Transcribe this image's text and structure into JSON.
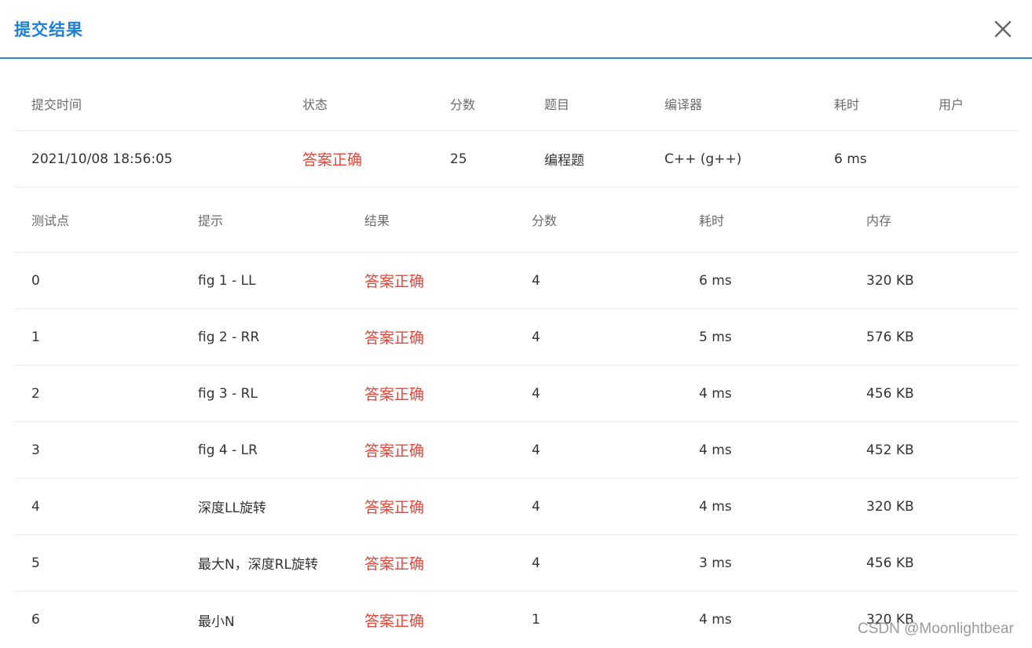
{
  "dialog": {
    "title": "提交结果",
    "close_icon": "close-icon"
  },
  "summary": {
    "headers": [
      "提交时间",
      "状态",
      "分数",
      "题目",
      "编译器",
      "耗时",
      "用户"
    ],
    "row": {
      "time": "2021/10/08 18:56:05",
      "status": "答案正确",
      "score": "25",
      "problem": "编程题",
      "compiler": "C++ (g++)",
      "duration": "6 ms",
      "user": ""
    }
  },
  "cases": {
    "headers": [
      "测试点",
      "提示",
      "结果",
      "分数",
      "耗时",
      "内存"
    ],
    "rows": [
      {
        "id": "0",
        "hint": "fig 1 - LL",
        "result": "答案正确",
        "score": "4",
        "time": "6 ms",
        "memory": "320 KB"
      },
      {
        "id": "1",
        "hint": "fig 2 - RR",
        "result": "答案正确",
        "score": "4",
        "time": "5 ms",
        "memory": "576 KB"
      },
      {
        "id": "2",
        "hint": "fig 3 - RL",
        "result": "答案正确",
        "score": "4",
        "time": "4 ms",
        "memory": "456 KB"
      },
      {
        "id": "3",
        "hint": "fig 4 - LR",
        "result": "答案正确",
        "score": "4",
        "time": "4 ms",
        "memory": "452 KB"
      },
      {
        "id": "4",
        "hint": "深度LL旋转",
        "result": "答案正确",
        "score": "4",
        "time": "4 ms",
        "memory": "320 KB"
      },
      {
        "id": "5",
        "hint": "最大N，深度RL旋转",
        "result": "答案正确",
        "score": "4",
        "time": "3 ms",
        "memory": "456 KB"
      },
      {
        "id": "6",
        "hint": "最小N",
        "result": "答案正确",
        "score": "1",
        "time": "4 ms",
        "memory": "320 KB"
      }
    ]
  },
  "watermark": "CSDN @Moonlightbear",
  "colors": {
    "accent": "#1f7fd6",
    "success": "#e2473a",
    "divider": "#ececec"
  }
}
